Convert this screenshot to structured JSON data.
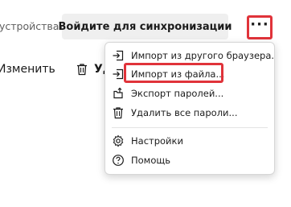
{
  "header": {
    "devices_text": "устройствах",
    "sync_button_label": "Войдите для синхронизации",
    "more_button_label": "···"
  },
  "toolbar": {
    "edit_label": "Изменить",
    "delete_label_partial": "Уд"
  },
  "menu": {
    "items": [
      {
        "label": "Импорт из другого браузера...",
        "icon": "import-icon"
      },
      {
        "label": "Импорт из файла...",
        "icon": "import-icon"
      },
      {
        "label": "Экспорт паролей...",
        "icon": "export-icon"
      },
      {
        "label": "Удалить все пароли...",
        "icon": "trash-icon"
      },
      {
        "label": "Настройки",
        "icon": "gear-icon"
      },
      {
        "label": "Помощь",
        "icon": "help-icon"
      }
    ]
  },
  "colors": {
    "highlight": "#e0333a",
    "button_bg": "#efefef"
  }
}
